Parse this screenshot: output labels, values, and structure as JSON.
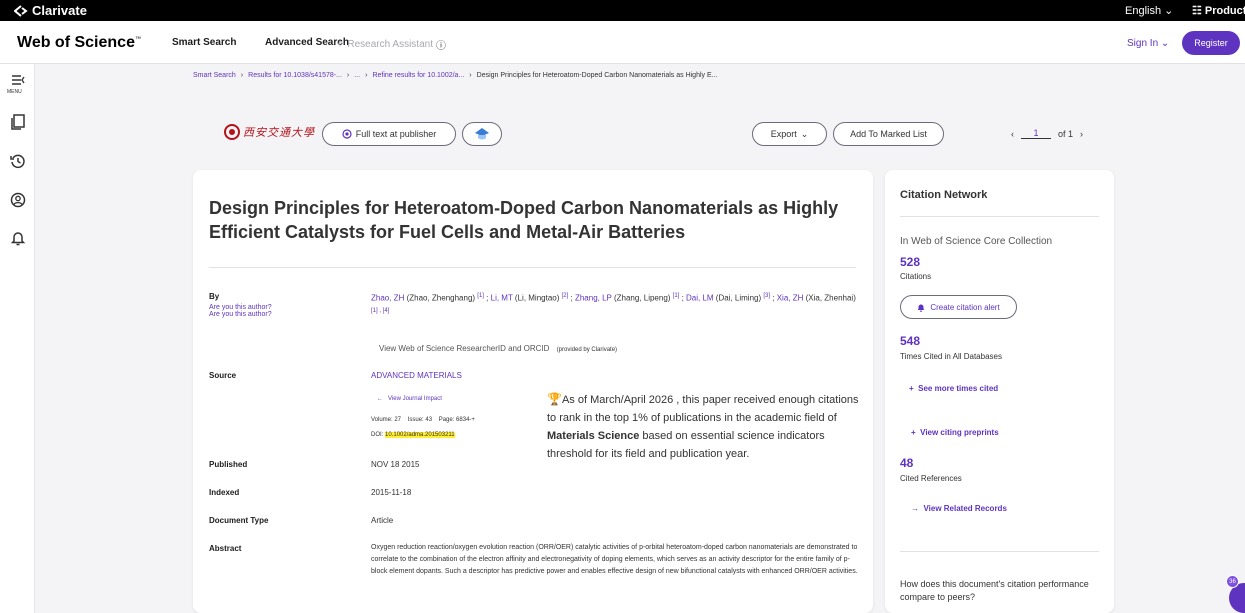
{
  "topbar": {
    "brand": "Clarivate",
    "language": "English",
    "products": "Products"
  },
  "nav": {
    "logo": "Web of Science",
    "logo_tm": "™",
    "smart_search": "Smart Search",
    "advanced_search": "Advanced Search",
    "research_assistant": "Research Assistant",
    "sign_in": "Sign In",
    "register": "Register"
  },
  "sidebar": {
    "menu_label": "MENU"
  },
  "breadcrumb": [
    {
      "label": "Smart Search"
    },
    {
      "label": "Results for 10.1038/s41578-..."
    },
    {
      "label": "..."
    },
    {
      "label": "Refine results for 10.1002/a..."
    },
    {
      "label": "Design Principles for Heteroatom-Doped Carbon Nanomaterials as Highly E..."
    }
  ],
  "toolbar": {
    "full_text": "Full text at publisher",
    "export": "Export",
    "add_marked": "Add To Marked List",
    "page_current": "1",
    "page_total": "of 1"
  },
  "record": {
    "title": "Design Principles for Heteroatom-Doped Carbon Nanomaterials as Highly Efficient Catalysts for Fuel Cells and Metal-Air Batteries",
    "by_label": "By",
    "are_you_1": "Are you this author?",
    "are_you_2": "Are you this author?",
    "authors": [
      {
        "short": "Zhao, ZH",
        "full": " (Zhao, Zhenghang) ",
        "aff": "[1]",
        "sep": " ; "
      },
      {
        "short": "Li, MT",
        "full": " (Li, Mingtao) ",
        "aff": "[2]",
        "sep": " ; "
      },
      {
        "short": "Zhang, LP",
        "full": " (Zhang, Lipeng) ",
        "aff": "[1]",
        "sep": " ; "
      },
      {
        "short": "Dai, LM",
        "full": " (Dai, Liming) ",
        "aff": "[3]",
        "sep": " ; "
      },
      {
        "short": "Xia, ZH",
        "full": " (Xia, Zhenhai) ",
        "aff": "[1] , [4]",
        "sep": ""
      }
    ],
    "researcher_link": "View Web of Science ResearcherID and ORCID",
    "provided_by": "(provided by Clarivate)",
    "source_label": "Source",
    "source": "ADVANCED MATERIALS",
    "journal_impact": "View Journal Impact",
    "volume": "Volume: 27    Issue: 43    Page: 6834-+",
    "doi_label": "DOI: ",
    "doi": "10.1002/adma.201503211",
    "hot_paper": {
      "prefix": "As of ",
      "period": "March/April 2026",
      "mid": " , this paper received enough citations to rank in the top 1% of publications in the academic field of ",
      "field": "Materials Science",
      "suffix": " based on essential science indicators threshold for its field and publication year."
    },
    "published_label": "Published",
    "published": "NOV 18 2015",
    "indexed_label": "Indexed",
    "indexed": "2015-11-18",
    "doctype_label": "Document Type",
    "doctype": "Article",
    "abstract_label": "Abstract",
    "abstract": "Oxygen reduction reaction/oxygen evolution reaction (ORR/OER) catalytic activities of p-orbital heteroatom-doped carbon nanomaterials are demonstrated to correlate to the combination of the electron affinity and electronegativity of doping elements, which serves as an activity descriptor for the entire family of p-block element dopants. Such a descriptor has predictive power and enables effective design of new bifunctional catalysts with enhanced ORR/OER activities."
  },
  "citation_network": {
    "title": "Citation Network",
    "collection": "In Web of Science Core Collection",
    "citations": "528",
    "citations_label": "Citations",
    "create_alert": "Create citation alert",
    "times_cited": "548",
    "times_cited_label": "Times Cited in All Databases",
    "see_more": "See more times cited",
    "view_preprints": "View citing preprints",
    "cited_refs": "48",
    "cited_refs_label": "Cited References",
    "view_related": "View Related Records",
    "peers": "How does this document's citation performance compare to peers?"
  },
  "chat_badge": {
    "count": "36"
  },
  "colors": {
    "accent": "#5e33bf",
    "highlight": "#ffee33",
    "trophy": "#b3131b"
  }
}
